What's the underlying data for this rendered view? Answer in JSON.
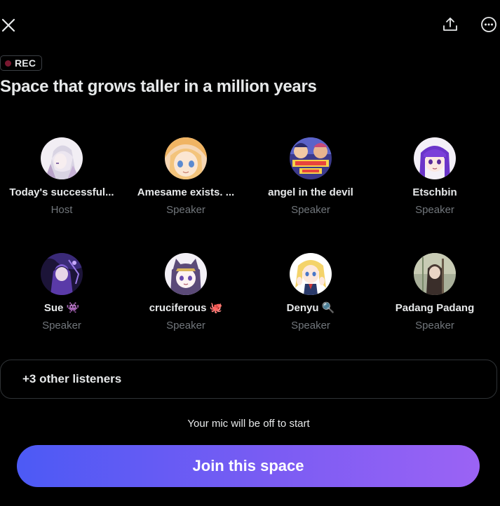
{
  "header": {
    "close_icon": "close-icon",
    "share_icon": "share-icon",
    "more_icon": "more-options-icon"
  },
  "recording": {
    "label": "REC",
    "dot_color": "#7a1830"
  },
  "space": {
    "title": "Space that grows taller in a million years"
  },
  "participants": [
    {
      "name": "Today's successful...",
      "role": "Host"
    },
    {
      "name": "Amesame exists. ...",
      "role": "Speaker"
    },
    {
      "name": "angel in the devil",
      "role": "Speaker"
    },
    {
      "name": "Etschbin",
      "role": "Speaker"
    },
    {
      "name": "Sue 👾",
      "role": "Speaker"
    },
    {
      "name": "cruciferous 🐙",
      "role": "Speaker"
    },
    {
      "name": "Denyu 🔍",
      "role": "Speaker"
    },
    {
      "name": "Padang Padang",
      "role": "Speaker"
    }
  ],
  "listeners": {
    "label": "+3 other listeners"
  },
  "mic_note": "Your mic will be off to start",
  "join_button": {
    "label": "Join this space",
    "gradient_start": "#4c5af5",
    "gradient_end": "#9b63f4"
  }
}
